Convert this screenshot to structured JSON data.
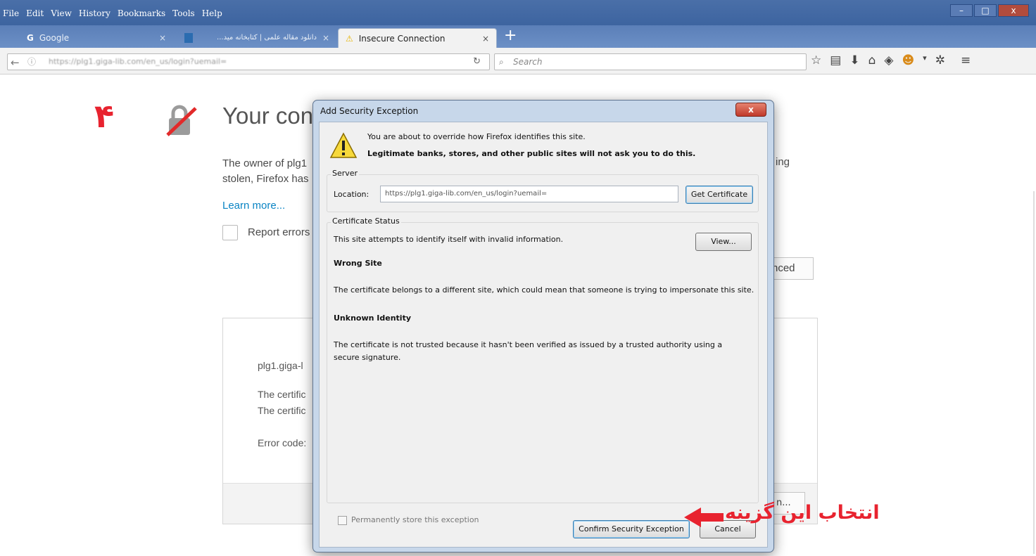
{
  "menu": [
    "File",
    "Edit",
    "View",
    "History",
    "Bookmarks",
    "Tools",
    "Help"
  ],
  "tabs": [
    {
      "label": "Google"
    },
    {
      "label": "دانلود مقاله علمی | کتابخانه مید..."
    },
    {
      "label": "Insecure Connection"
    }
  ],
  "navbar": {
    "url": "https://plg1.giga-lib.com/en_us/login?uemail=",
    "search_placeholder": "Search"
  },
  "page": {
    "step_number": "۴",
    "title": "Your con",
    "text_line1": "The owner of plg1",
    "text_line2": "stolen, Firefox has",
    "text_tail": "ing",
    "learn_more": "Learn more...",
    "report_label": "Report errors",
    "advanced_label": "nced",
    "details_host": "plg1.giga-l",
    "details_cert1": "The certific",
    "details_cert2": "The certific",
    "details_error": "Error code:",
    "add_exception_label": "n..."
  },
  "dialog": {
    "title": "Add Security Exception",
    "close_label": "x",
    "warning_line1": "You are about to override how Firefox identifies this site.",
    "warning_line2": "Legitimate banks, stores, and other public sites will not ask you to do this.",
    "server_label": "Server",
    "location_label": "Location:",
    "location_value": "https://plg1.giga-lib.com/en_us/login?uemail=",
    "get_certificate": "Get Certificate",
    "status_label": "Certificate Status",
    "status_text": "This site attempts to identify itself with invalid information.",
    "view_button": "View...",
    "wrong_site_title": "Wrong Site",
    "wrong_site_text": "The certificate belongs to a different site, which could mean that someone is trying to impersonate this site.",
    "unknown_identity_title": "Unknown Identity",
    "unknown_identity_text": "The certificate is not trusted because it hasn't been verified as issued by a trusted authority using a secure signature.",
    "permanent_label": "Permanently store this exception",
    "permanent_checked": false,
    "confirm_button": "Confirm Security Exception",
    "cancel_button": "Cancel"
  },
  "annotation": {
    "text": "انتخاب این گزینه",
    "color": "#e8232f"
  }
}
